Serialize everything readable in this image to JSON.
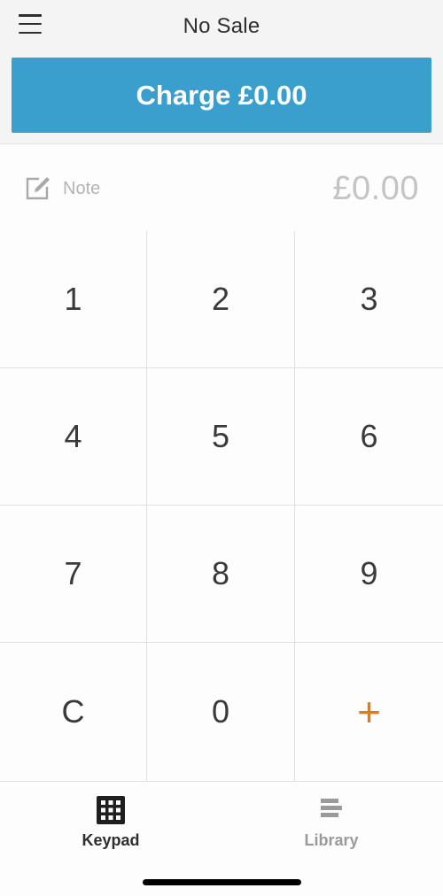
{
  "header": {
    "title": "No Sale",
    "menu_icon": "hamburger-menu-icon"
  },
  "charge_button": {
    "label": "Charge £0.00"
  },
  "note_row": {
    "icon": "edit-note-icon",
    "label": "Note",
    "amount": "£0.00"
  },
  "keypad": {
    "keys": [
      "1",
      "2",
      "3",
      "4",
      "5",
      "6",
      "7",
      "8",
      "9",
      "C",
      "0",
      "+"
    ]
  },
  "bottom_nav": {
    "tabs": [
      {
        "label": "Keypad",
        "icon": "keypad-grid-icon",
        "active": true
      },
      {
        "label": "Library",
        "icon": "library-list-icon",
        "active": false
      }
    ]
  },
  "colors": {
    "brand_blue": "#3a9fcd",
    "accent_orange": "#e27b14",
    "background": "#f4f4f5"
  }
}
